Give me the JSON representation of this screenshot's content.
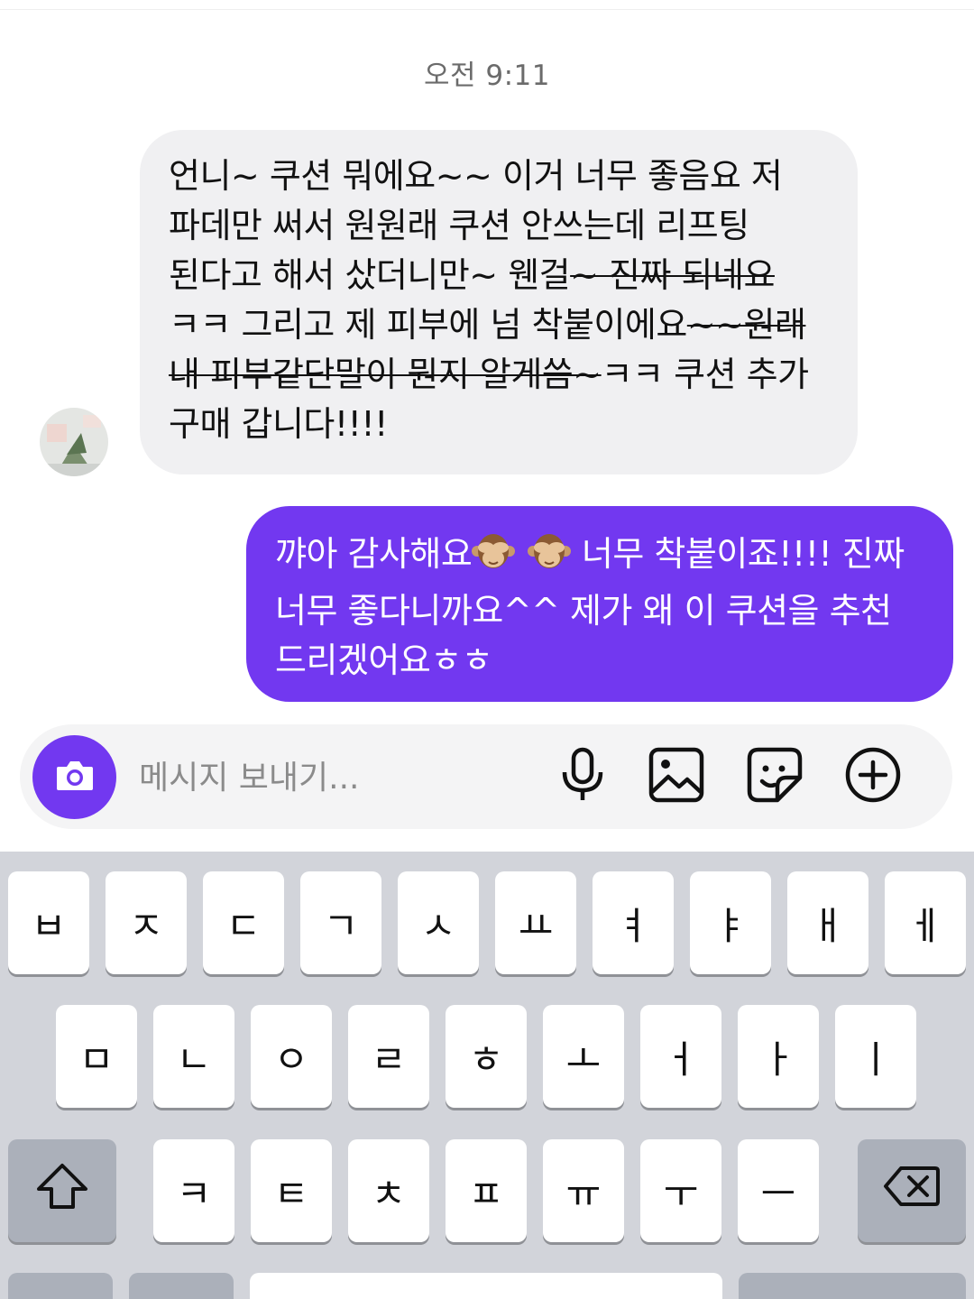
{
  "chat": {
    "timestamp": "오전 9:11",
    "incoming": {
      "parts": [
        "언니~ 쿠션 뭐에요~~ 이거 너무 좋음요 저 파데만 써서 원원래 쿠션 안쓰는데 리프팅 된다고 해서 샀더니만~ 웬걸",
        "~ 진짜 되네요",
        " ㅋㅋ 그리고 제 피부에 넘 착붙이에요",
        "~~원래 내 피부같단말이 뭔지 알게씀~",
        "ㅋㅋ 쿠션 추가 구매 갑니다!!!!"
      ]
    },
    "outgoing": {
      "part1": "꺄아 감사해요",
      "emoji1": "see-no-evil-monkey",
      "emoji2": "see-no-evil-monkey",
      "part2": " 너무 착붙이죠!!!! 진짜 너무 좋다니까요^^ 제가 왜 이 쿠션을 추천 드리겠어요ㅎㅎ"
    }
  },
  "composer": {
    "placeholder": "메시지 보내기...",
    "value": "",
    "camera_icon": "camera-icon",
    "mic_icon": "microphone-icon",
    "gallery_icon": "image-icon",
    "sticker_icon": "sticker-icon",
    "plus_icon": "plus-circle-icon",
    "accent_color": "#7238f0"
  },
  "keyboard": {
    "row1": [
      "ㅂ",
      "ㅈ",
      "ㄷ",
      "ㄱ",
      "ㅅ",
      "ㅛ",
      "ㅕ",
      "ㅑ",
      "ㅐ",
      "ㅔ"
    ],
    "row2": [
      "ㅁ",
      "ㄴ",
      "ㅇ",
      "ㄹ",
      "ㅎ",
      "ㅗ",
      "ㅓ",
      "ㅏ",
      "ㅣ"
    ],
    "row3": [
      "ㅋ",
      "ㅌ",
      "ㅊ",
      "ㅍ",
      "ㅠ",
      "ㅜ",
      "ㅡ"
    ],
    "shift_icon": "shift-icon",
    "backspace_icon": "backspace-icon"
  }
}
